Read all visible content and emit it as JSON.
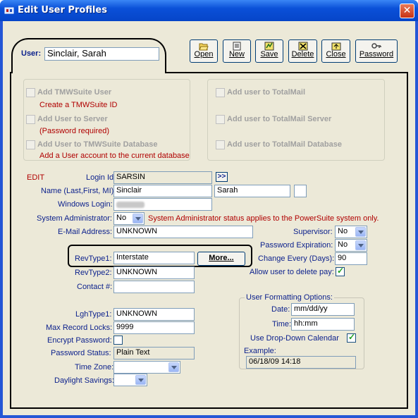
{
  "window": {
    "title": "Edit User Profiles",
    "close_glyph": "✕"
  },
  "user": {
    "label": "User:",
    "value": "Sinclair, Sarah"
  },
  "toolbar": [
    {
      "label": "Open",
      "icon": "open-folder-icon"
    },
    {
      "label": "New",
      "icon": "new-document-icon"
    },
    {
      "label": "Save",
      "icon": "save-icon"
    },
    {
      "label": "Delete",
      "icon": "delete-icon"
    },
    {
      "label": "Close",
      "icon": "close-folder-icon"
    },
    {
      "label": "Password",
      "icon": "key-icon"
    }
  ],
  "add_options": {
    "tmwsuite_user": "Add TMWSuite User",
    "tmwsuite_user_note": "Create a TMWSuite ID",
    "user_to_server": "Add User to Server",
    "user_to_server_note": "(Password required)",
    "user_to_db": "Add User to TMWSuite Database",
    "user_to_db_note": "Add a User account to the current database",
    "totalmail": "Add user to TotalMail",
    "totalmail_server": "Add user to TotalMail Server",
    "totalmail_db": "Add user to TotalMail Database"
  },
  "mode": "EDIT",
  "form": {
    "login_id_label": "Login Id:",
    "login_id": "SARSIN",
    "login_btn": ">>",
    "name_label": "Name (Last,First, MI):",
    "last_name": "Sinclair",
    "first_name": "Sarah",
    "mi": "",
    "windows_login_label": "Windows Login:",
    "sysadmin_label": "System Administrator:",
    "sysadmin_value": "No",
    "sysadmin_note": "System Administrator status applies to the PowerSuite system only.",
    "email_label": "E-Mail Address:",
    "email": "UNKNOWN",
    "revtype1_label": "RevType1:",
    "revtype1": "Interstate",
    "more_btn": "More...",
    "revtype2_label": "RevType2:",
    "revtype2": "UNKNOWN",
    "contact_label": "Contact #:",
    "contact": "",
    "lghtype1_label": "LghType1:",
    "lghtype1": "UNKNOWN",
    "max_locks_label": "Max Record Locks:",
    "max_locks": "9999",
    "encrypt_label": "Encrypt Password:",
    "pw_status_label": "Password Status:",
    "pw_status": "Plain Text",
    "timezone_label": "Time Zone:",
    "timezone": "",
    "dst_label": "Daylight Savings:",
    "dst": ""
  },
  "right": {
    "supervisor_label": "Supervisor:",
    "supervisor": "No",
    "pw_exp_label": "Password Expiration:",
    "pw_exp": "No",
    "change_every_label": "Change Every (Days):",
    "change_every": "90",
    "allow_delete_pay_label": "Allow user to delete pay:"
  },
  "formatting": {
    "title": "User Formatting Options:",
    "date_label": "Date:",
    "date": "mm/dd/yy",
    "time_label": "Time:",
    "time": "hh:mm",
    "calendar_label": "Use Drop-Down Calendar",
    "example_label": "Example:",
    "example": "06/18/09 14:18"
  },
  "colors": {
    "title_bar": "#0a50d8",
    "label_blue": "#0a1f8c",
    "note_red": "#b00000",
    "panel_bg": "#ece9d8"
  }
}
